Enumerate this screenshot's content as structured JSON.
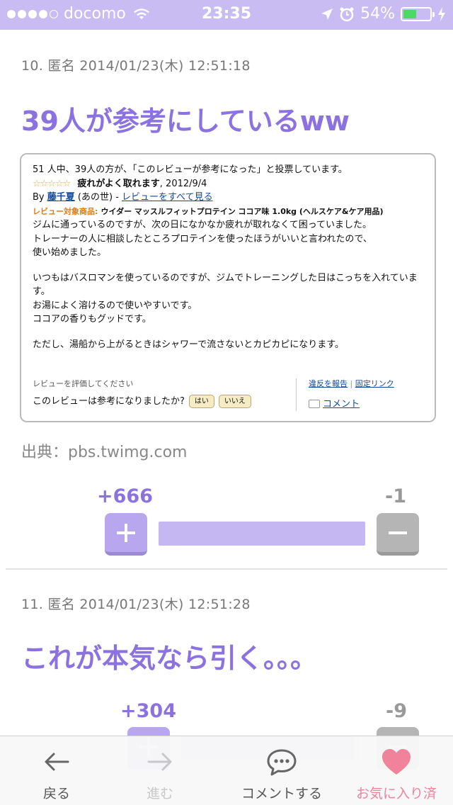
{
  "status_bar": {
    "carrier": "docomo",
    "time": "23:35",
    "battery": "54%",
    "battery_level": 0.54
  },
  "posts": [
    {
      "meta": "10. 匿名 2014/01/23(木) 12:51:18",
      "title": "39人が参考にしているww",
      "source": "出典：pbs.twimg.com",
      "plus": "+666",
      "minus": "-1",
      "ratio": 0.9985
    },
    {
      "meta": "11. 匿名 2014/01/23(木) 12:51:28",
      "title": "これが本気なら引く。。。",
      "plus": "+304",
      "minus": "-9",
      "ratio": 0.9712
    }
  ],
  "review": {
    "helpful_summary": "51 人中、39人の方が、「このレビューが参考になった」と投票しています。",
    "stars": "☆☆☆☆☆",
    "headline": "疲れがよく取れます",
    "date": ", 2012/9/4",
    "by": "By",
    "author": "藤千夏",
    "author_suffix": "(あの世) -",
    "all_reviews_link": "レビューをすべて見る",
    "product_label": "レビュー対象商品:",
    "product": "ウイダー マッスルフィットプロテイン ココア味 1.0kg (ヘルスケア&ケア用品)",
    "body": [
      "ジムに通っているのですが、次の日になかなか疲れが取れなくて困っていました。",
      "トレーナーの人に相談したところプロテインを使ったほうがいいと言われたので、",
      "使い始めました。",
      "",
      "いつもはバスロマンを使っているのですが、ジムでトレーニングした日はこっちを入れていま",
      "す。",
      "お湯によく溶けるので使いやすいです。",
      "ココアの香りもグッドです。",
      "",
      "ただし、湯船から上がるときはシャワーで流さないとカピカピになります。"
    ],
    "rate_label": "レビューを評価してください",
    "question": "このレビューは参考になりましたか?",
    "yes": "はい",
    "no": "いいえ",
    "report": "違反を報告",
    "permalink": "固定リンク",
    "comment": "コメント"
  },
  "toolbar": {
    "back": "戻る",
    "forward": "進む",
    "comment": "コメントする",
    "favorite": "お気に入り済"
  },
  "colors": {
    "accent": "#8b72e0",
    "status_bar": "#c8bcf2",
    "favorite": "#f0829b"
  }
}
